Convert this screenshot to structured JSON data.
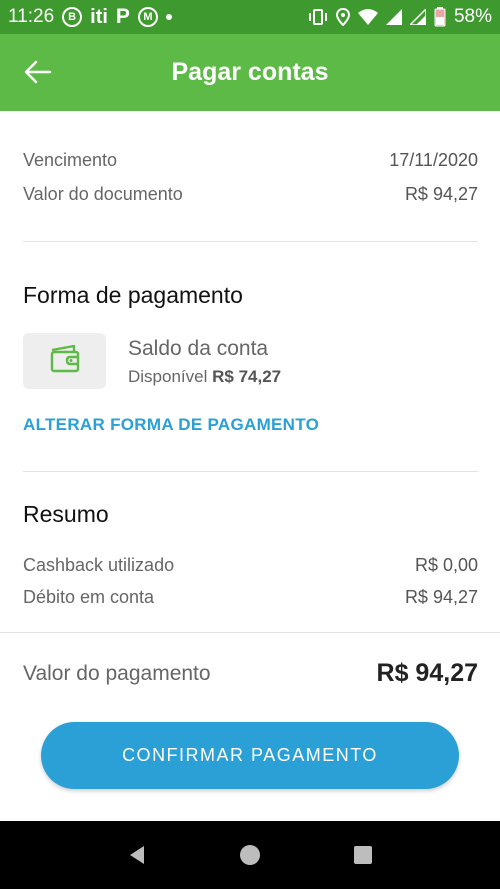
{
  "status_bar": {
    "time": "11:26",
    "app_icons": [
      "B",
      "iti",
      "P",
      "M"
    ],
    "battery_percent": "58%"
  },
  "header": {
    "title": "Pagar contas"
  },
  "document": {
    "due_label": "Vencimento",
    "due_value": "17/11/2020",
    "value_label": "Valor do documento",
    "value_value": "R$ 94,27"
  },
  "payment_method": {
    "section_title": "Forma de pagamento",
    "name": "Saldo da conta",
    "available_label": "Disponível",
    "available_value": "R$ 74,27",
    "change_link": "ALTERAR FORMA DE PAGAMENTO"
  },
  "summary": {
    "section_title": "Resumo",
    "cashback_label": "Cashback utilizado",
    "cashback_value": "R$ 0,00",
    "debit_label": "Débito em conta",
    "debit_value": "R$ 94,27"
  },
  "total": {
    "label": "Valor do pagamento",
    "value": "R$ 94,27"
  },
  "confirm_button": "CONFIRMAR PAGAMENTO",
  "colors": {
    "status_bar": "#3e9a2e",
    "app_bar": "#5dba47",
    "accent": "#2aa0d6",
    "wallet_icon": "#5dba47"
  }
}
